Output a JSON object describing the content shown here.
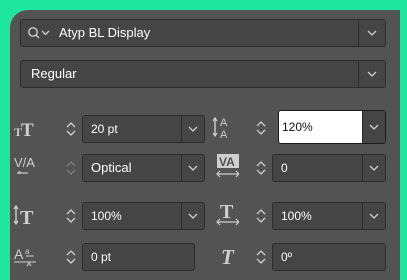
{
  "font": {
    "family": "Atyp BL Display",
    "style": "Regular"
  },
  "fields": {
    "size": "20 pt",
    "leading": "120%",
    "kerning": "Optical",
    "tracking": "0",
    "vertical_scale": "100%",
    "horizontal_scale": "100%",
    "baseline_shift": "0 pt",
    "skew": "0º"
  },
  "colors": {
    "accent": "#1ee6a0",
    "panel": "#535353",
    "field": "#454545",
    "border": "#2b2b2b"
  }
}
